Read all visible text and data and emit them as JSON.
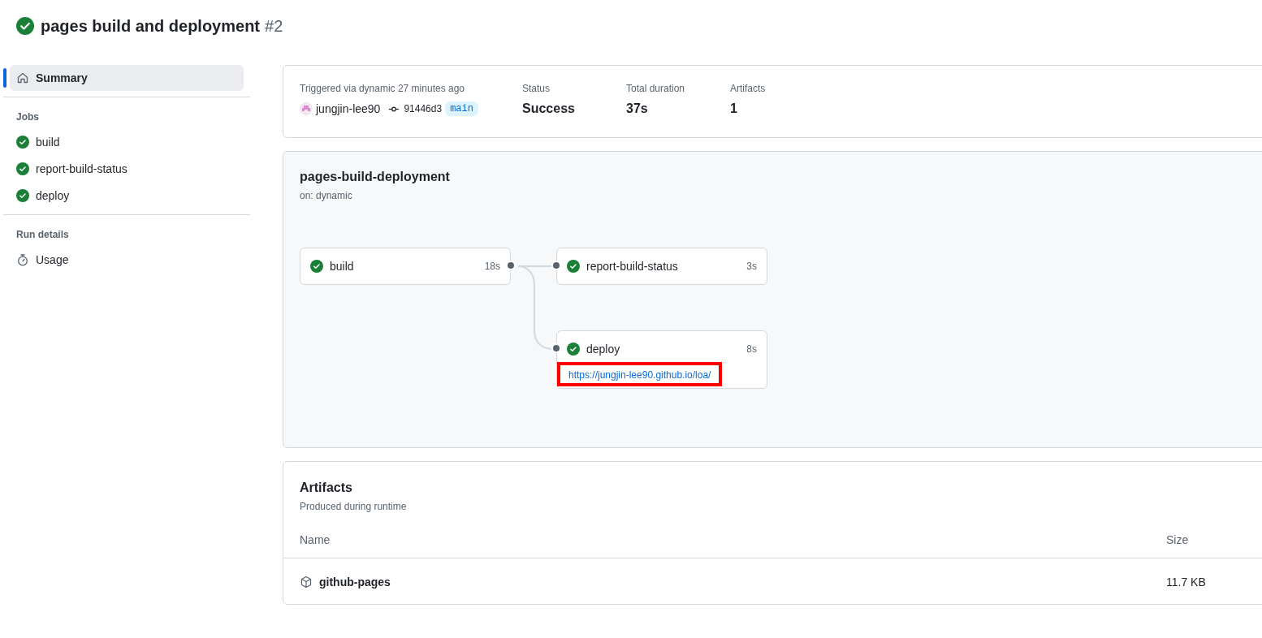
{
  "header": {
    "title": "pages build and deployment",
    "run_number": "#2"
  },
  "sidebar": {
    "summary": {
      "label": "Summary",
      "selected": true
    },
    "jobs_heading": "Jobs",
    "jobs": [
      {
        "name": "build",
        "selected": false
      },
      {
        "name": "report-build-status",
        "selected": false
      },
      {
        "name": "deploy",
        "selected": false
      }
    ],
    "run_details_heading": "Run details",
    "run_details": [
      {
        "label": "Usage",
        "selected": false
      }
    ]
  },
  "summary": {
    "trigger": "Triggered via dynamic 27 minutes ago",
    "actor": "jungjin-lee90",
    "commit": "91446d3",
    "branch": "main",
    "stats": [
      {
        "label": "Status",
        "value": "Success"
      },
      {
        "label": "Total duration",
        "value": "37s"
      },
      {
        "label": "Artifacts",
        "value": "1"
      }
    ]
  },
  "workflow": {
    "name": "pages-build-deployment",
    "trigger": "on: dynamic",
    "jobs": [
      {
        "name": "build",
        "duration": "18s"
      },
      {
        "name": "report-build-status",
        "duration": "3s"
      },
      {
        "name": "deploy",
        "duration": "8s",
        "url": "https://jungjin-lee90.github.io/loa/",
        "highlighted": true
      }
    ]
  },
  "artifacts": {
    "title": "Artifacts",
    "subtitle": "Produced during runtime",
    "columns": [
      "Name",
      "Size"
    ],
    "rows": [
      {
        "name": "github-pages",
        "size": "11.7 KB"
      }
    ]
  }
}
